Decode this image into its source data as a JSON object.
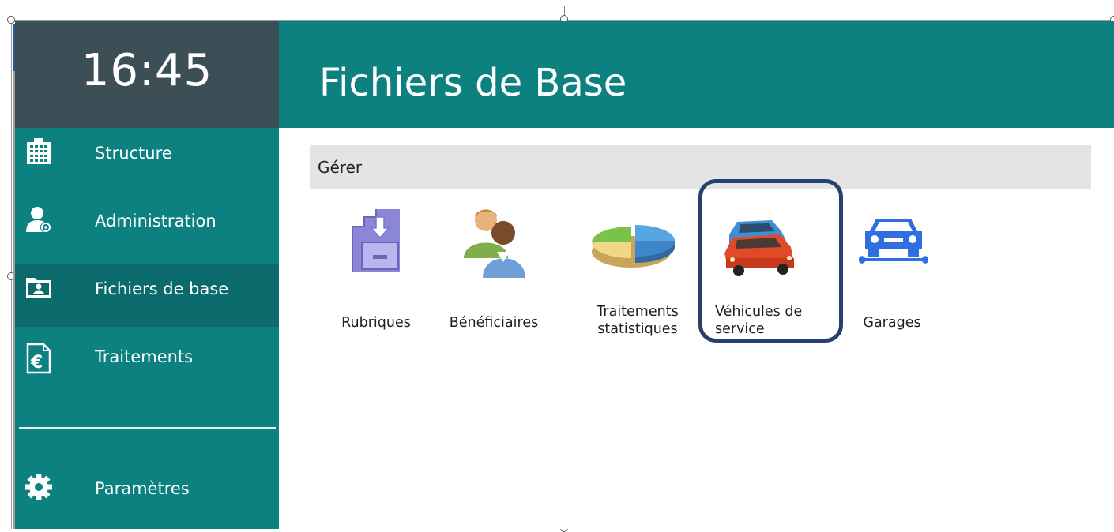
{
  "clock": "16:45",
  "page_title": "Fichiers de Base",
  "sidebar": {
    "items": [
      {
        "label": "Structure",
        "icon": "building-icon"
      },
      {
        "label": "Administration",
        "icon": "user-gear-icon"
      },
      {
        "label": "Fichiers de base",
        "icon": "folder-user-icon",
        "active": true
      },
      {
        "label": "Traitements",
        "icon": "euro-document-icon"
      }
    ],
    "settings": {
      "label": "Paramètres",
      "icon": "gear-icon"
    }
  },
  "section": {
    "label": "Gérer"
  },
  "tiles": [
    {
      "label": "Rubriques",
      "icon": "drawer-download-icon"
    },
    {
      "label": "Bénéficiaires",
      "icon": "people-icon"
    },
    {
      "label_line1": "Traitements",
      "label_line2": "statistiques",
      "icon": "pie-chart-icon"
    },
    {
      "label_line1": "Véhicules de",
      "label_line2": "service",
      "icon": "cars-icon",
      "highlighted": true
    },
    {
      "label": "Garages",
      "icon": "car-wrench-icon"
    }
  ],
  "colors": {
    "teal": "#0d8080",
    "teal_active": "#0b6a6b",
    "clock_bg": "#3d4f56",
    "highlight_border": "#27406d",
    "section_bg": "#e4e4e4"
  }
}
